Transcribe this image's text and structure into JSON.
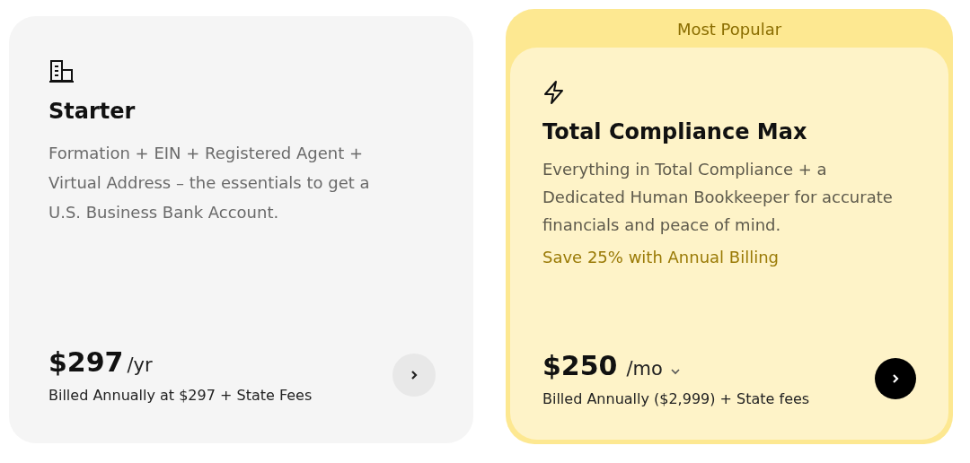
{
  "plans": [
    {
      "kind": "basic",
      "name": "Starter",
      "description": "Formation + EIN + Registered Agent + Virtual Address – the essentials to get a U.S. Business Bank Account.",
      "price": "$297",
      "period": "/yr",
      "period_menu": false,
      "billing": "Billed Annually at $297 + State Fees"
    },
    {
      "kind": "featured",
      "badge": "Most Popular",
      "name": "Total Compliance Max",
      "description": "Everything in Total Compliance + a Dedicated Human Bookkeeper for accurate financials and peace of mind.",
      "highlight": "Save 25% with Annual Billing",
      "price": "$250",
      "period": "/mo",
      "period_menu": true,
      "billing": "Billed Annually ($2,999) + State fees"
    }
  ]
}
